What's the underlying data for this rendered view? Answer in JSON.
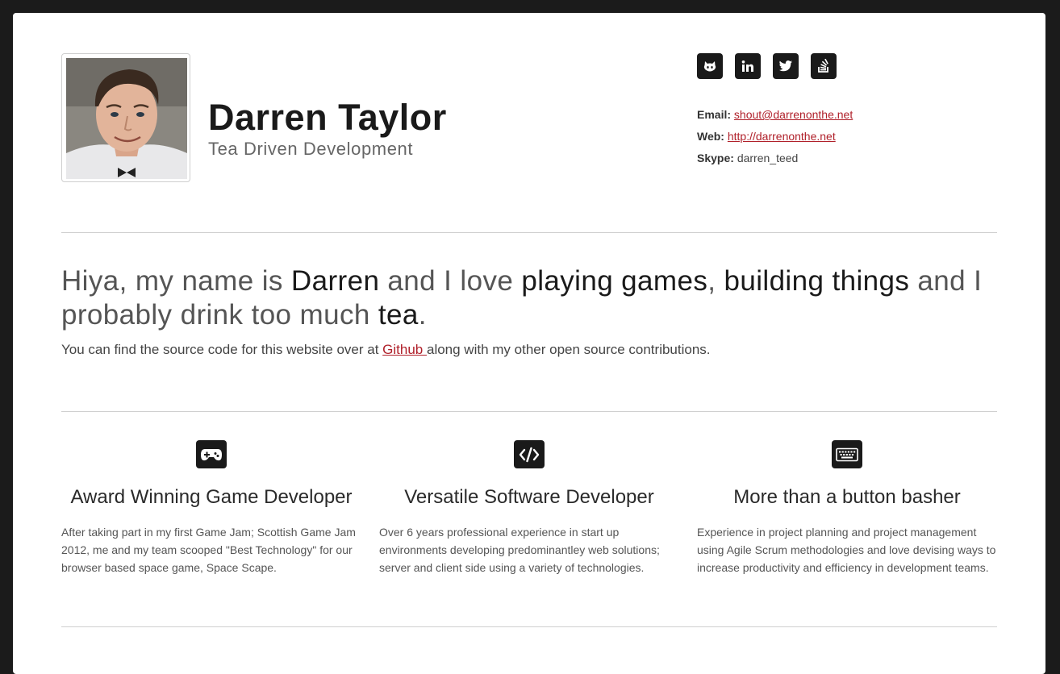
{
  "header": {
    "name": "Darren Taylor",
    "tagline": "Tea Driven Development"
  },
  "social": [
    {
      "icon": "github-icon",
      "name": "github-link"
    },
    {
      "icon": "linkedin-icon",
      "name": "linkedin-link"
    },
    {
      "icon": "twitter-icon",
      "name": "twitter-link"
    },
    {
      "icon": "stackoverflow-icon",
      "name": "stackoverflow-link"
    }
  ],
  "contact": {
    "email_label": "Email:",
    "email_value": "shout@darrenonthe.net",
    "web_label": "Web:",
    "web_value": "http://darrenonthe.net",
    "skype_label": "Skype:",
    "skype_value": "darren_teed"
  },
  "intro": {
    "p1": "Hiya, my name is ",
    "name": "Darren",
    "p2": " and I love ",
    "games": "playing games",
    "comma": ", ",
    "building": "building things",
    "p3": " and I probably drink too much ",
    "tea": "tea",
    "period": ".",
    "source_before": "You can find the source code for this website over at ",
    "source_link": "Github ",
    "source_after": "along with my other open source contributions."
  },
  "features": [
    {
      "icon": "gamepad-icon",
      "title": "Award Winning Game Developer",
      "text": "After taking part in my first Game Jam; Scottish Game Jam 2012, me and my team scooped \"Best Technology\" for our browser based space game, Space Scape."
    },
    {
      "icon": "code-icon",
      "title": "Versatile Software Developer",
      "text": "Over 6 years professional experience in start up environments developing predominantley web solutions; server and client side using a variety of technologies."
    },
    {
      "icon": "keyboard-icon",
      "title": "More than a button basher",
      "text": "Experience in project planning and project management using Agile Scrum methodologies and love devising ways to increase productivity and efficiency in development teams."
    }
  ],
  "colors": {
    "background": "#1b1b1b",
    "card": "#ffffff",
    "accent_link": "#b0202a",
    "icon_bg": "#1a1a1a"
  }
}
